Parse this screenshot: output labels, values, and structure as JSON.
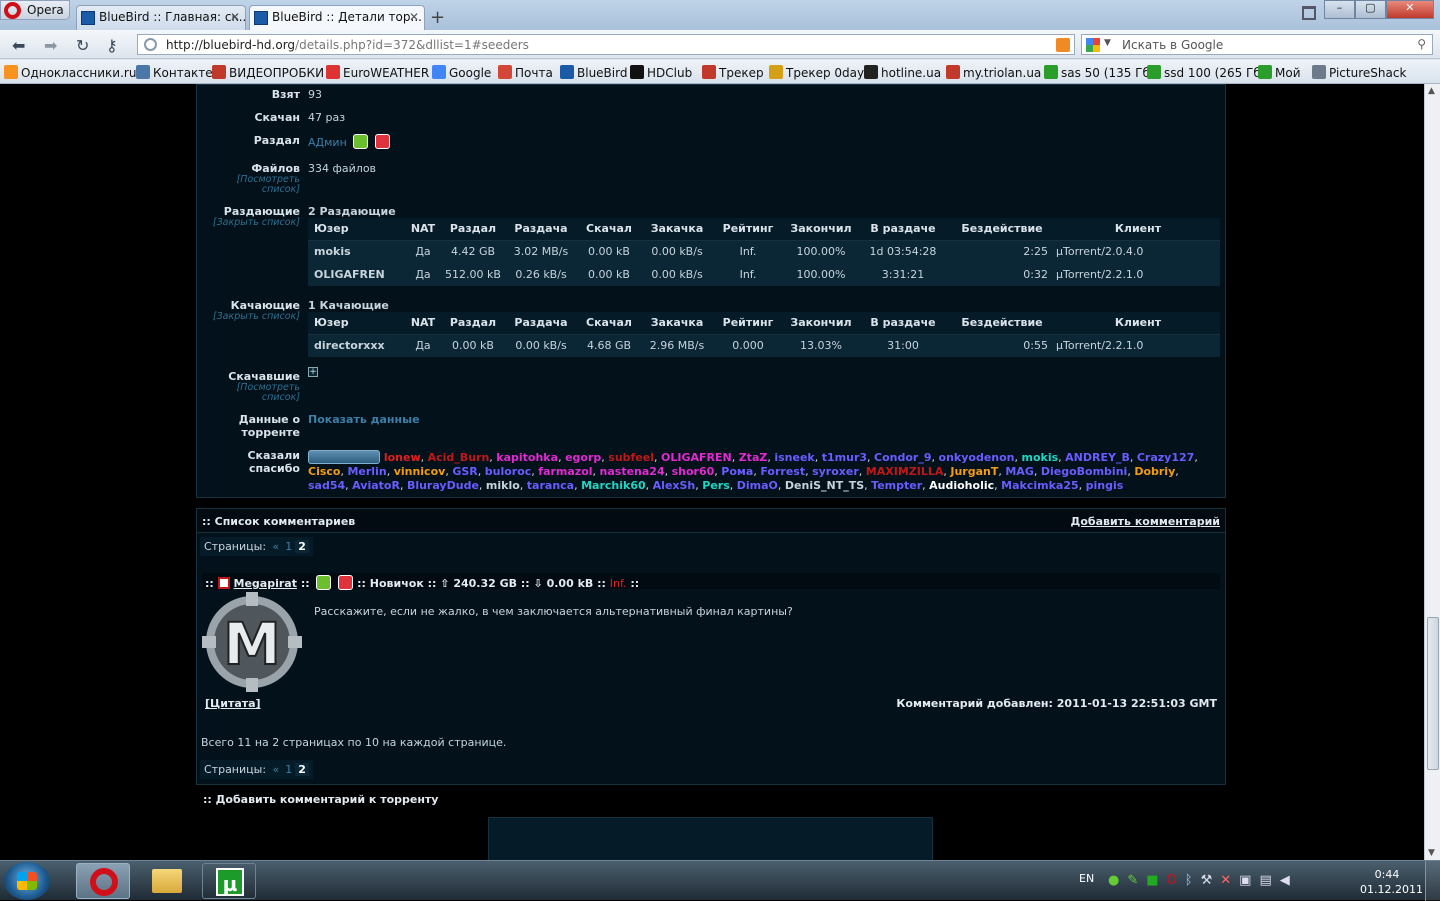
{
  "browser": {
    "opera_label": "Opera",
    "tabs": [
      {
        "label": "BlueBird :: Главная: ск..."
      },
      {
        "label": "BlueBird :: Детали тор..."
      }
    ],
    "url_host": "http://bluebird-hd.org",
    "url_path": "/details.php?id=372&dllist=1#seeders",
    "search_placeholder": "Искать в Google",
    "bookmarks": [
      {
        "label": "Одноклассники.ru",
        "color": "#f7931e"
      },
      {
        "label": "Контакте",
        "color": "#4a76a8"
      },
      {
        "label": "ВИДЕОПРОБКИ",
        "color": "#c0392b"
      },
      {
        "label": "EuroWEATHER",
        "color": "#d33"
      },
      {
        "label": "Google",
        "color": "#4285f4"
      },
      {
        "label": "Почта",
        "color": "#d44638"
      },
      {
        "label": "BlueBird",
        "color": "#1a5aa6"
      },
      {
        "label": "HDClub",
        "color": "#111"
      },
      {
        "label": "Трекер",
        "color": "#c0392b"
      },
      {
        "label": "Трекер 0day",
        "color": "#d4a017"
      },
      {
        "label": "hotline.ua",
        "color": "#222"
      },
      {
        "label": "my.triolan.ua",
        "color": "#c0392b"
      },
      {
        "label": "sas 50 (135 Гб)",
        "color": "#2a9d2a"
      },
      {
        "label": "ssd 100 (265 Гб)",
        "color": "#2a9d2a"
      },
      {
        "label": "Мой",
        "color": "#2a9d2a"
      },
      {
        "label": "PictureShack",
        "color": "#6c7a89"
      }
    ]
  },
  "details": {
    "taken_label": "Взят",
    "taken_value": "93",
    "downloaded_label": "Скачан",
    "downloaded_value": "47 раз",
    "uploader_label": "Раздал",
    "uploader_value": "АДмин",
    "files_label": "Файлов",
    "files_sub": "[Посмотреть список]",
    "files_value": "334 файлов",
    "seeders_label": "Раздающие",
    "seeders_sub": "[Закрыть список]",
    "seeders_value": "2 Раздающие",
    "leechers_label": "Качающие",
    "leechers_sub": "[Закрыть список]",
    "leechers_value": "1 Качающие",
    "completed_label": "Скачавшие",
    "completed_sub": "[Посмотреть список]",
    "completed_value": "+",
    "torrent_data_label": "Данные о торренте",
    "torrent_data_value": "Показать данные",
    "thanks_label": "Сказали спасибо"
  },
  "peer_columns": [
    "Юзер",
    "NAT",
    "Раздал",
    "Раздача",
    "Скачал",
    "Закачка",
    "Рейтинг",
    "Закончил",
    "В раздаче",
    "Бездействие",
    "Клиент"
  ],
  "seeders": [
    {
      "user": "mokis",
      "nat": "Да",
      "uploaded": "4.42 GB",
      "up_rate": "3.02 MB/s",
      "downloaded": "0.00 kB",
      "down_rate": "0.00 kB/s",
      "ratio": "Inf.",
      "done": "100.00%",
      "seeding": "1d 03:54:28",
      "idle": "2:25",
      "client": "µTorrent/2.0.4.0"
    },
    {
      "user": "OLIGAFREN",
      "nat": "Да",
      "uploaded": "512.00 kB",
      "up_rate": "0.26 kB/s",
      "downloaded": "0.00 kB",
      "down_rate": "0.00 kB/s",
      "ratio": "Inf.",
      "done": "100.00%",
      "seeding": "3:31:21",
      "idle": "0:32",
      "client": "µTorrent/2.2.1.0"
    }
  ],
  "leechers": [
    {
      "user": "directorxxx",
      "nat": "Да",
      "uploaded": "0.00 kB",
      "up_rate": "0.00 kB/s",
      "downloaded": "4.68 GB",
      "down_rate": "2.96 MB/s",
      "ratio": "0.000",
      "done": "13.03%",
      "seeding": "31:00",
      "idle": "0:55",
      "client": "µTorrent/2.2.1.0"
    }
  ],
  "thanks_users": [
    {
      "name": "lonew",
      "color": "#e02020"
    },
    {
      "name": "Acid_Burn",
      "color": "#c01818"
    },
    {
      "name": "kapitohka",
      "color": "#e22ad1"
    },
    {
      "name": "egorp",
      "color": "#e22ad1"
    },
    {
      "name": "subfeel",
      "color": "#c01818"
    },
    {
      "name": "OLIGAFREN",
      "color": "#e22ad1"
    },
    {
      "name": "ZtaZ",
      "color": "#e22ad1"
    },
    {
      "name": "isneek",
      "color": "#6a5cff"
    },
    {
      "name": "t1mur3",
      "color": "#6a5cff"
    },
    {
      "name": "Condor_9",
      "color": "#6a5cff"
    },
    {
      "name": "onkyodenon",
      "color": "#6a5cff"
    },
    {
      "name": "mokis",
      "color": "#1fd6c2"
    },
    {
      "name": "ANDREY_B",
      "color": "#6a5cff"
    },
    {
      "name": "Crazy127",
      "color": "#6a5cff"
    },
    {
      "name": "Cisco",
      "color": "#f39c12"
    },
    {
      "name": "Merlin",
      "color": "#6a5cff"
    },
    {
      "name": "vinnicov",
      "color": "#f39c12"
    },
    {
      "name": "GSR",
      "color": "#6a5cff"
    },
    {
      "name": "buloroc",
      "color": "#6a5cff"
    },
    {
      "name": "farmazol",
      "color": "#e22ad1"
    },
    {
      "name": "nastena24",
      "color": "#e22ad1"
    },
    {
      "name": "shor60",
      "color": "#e22ad1"
    },
    {
      "name": "Рома",
      "color": "#6a5cff"
    },
    {
      "name": "Forrest",
      "color": "#6a5cff"
    },
    {
      "name": "syroxer",
      "color": "#6a5cff"
    },
    {
      "name": "MAXIMZILLA",
      "color": "#c01818"
    },
    {
      "name": "JurganT",
      "color": "#f39c12"
    },
    {
      "name": "MAG",
      "color": "#6a5cff"
    },
    {
      "name": "DiegoBombini",
      "color": "#6a5cff"
    },
    {
      "name": "Dobriy",
      "color": "#f39c12"
    },
    {
      "name": "sad54",
      "color": "#6a5cff"
    },
    {
      "name": "AviatoR",
      "color": "#6a5cff"
    },
    {
      "name": "BlurayDude",
      "color": "#6a5cff"
    },
    {
      "name": "miklo",
      "color": "#c8d4dc"
    },
    {
      "name": "taranca",
      "color": "#6a5cff"
    },
    {
      "name": "Marchik60",
      "color": "#1fd6c2"
    },
    {
      "name": "AlexSh",
      "color": "#6a5cff"
    },
    {
      "name": "Pers",
      "color": "#1fd6c2"
    },
    {
      "name": "DimaO",
      "color": "#6a5cff"
    },
    {
      "name": "DeniS_NT_TS",
      "color": "#c8d4dc"
    },
    {
      "name": "Tempter",
      "color": "#6a5cff"
    },
    {
      "name": "Audioholic",
      "color": "#ffffff"
    },
    {
      "name": "Makcimka25",
      "color": "#6a5cff"
    },
    {
      "name": "pingis",
      "color": "#6a5cff"
    }
  ],
  "comments": {
    "title": ":: Список комментариев",
    "add_link": "Добавить комментарий",
    "pages_label": "Страницы:",
    "pages_prev": "«",
    "pages": [
      "1",
      "2"
    ],
    "author_prefix": "::",
    "author": "Megapirat",
    "sep": "::",
    "rank": ":: Новичок ::",
    "up_amount": "240.32 GB",
    "sep2": "::",
    "down_amount": "0.00 kB",
    "sep3": "::",
    "ratio": "Inf.",
    "sep4": "::",
    "text": "Расскажите, если не жалко, в чем заключается альтернативный финал картины?",
    "quote": "[Цитата]",
    "added": "Комментарий добавлен: 2011-01-13 22:51:03 GMT",
    "total": "Всего 11 на 2 страницах по 10 на каждой странице.",
    "add_torrent_comment": ":: Добавить комментарий к торренту"
  },
  "taskbar": {
    "lang": "EN",
    "time": "0:44",
    "date": "01.12.2011"
  }
}
